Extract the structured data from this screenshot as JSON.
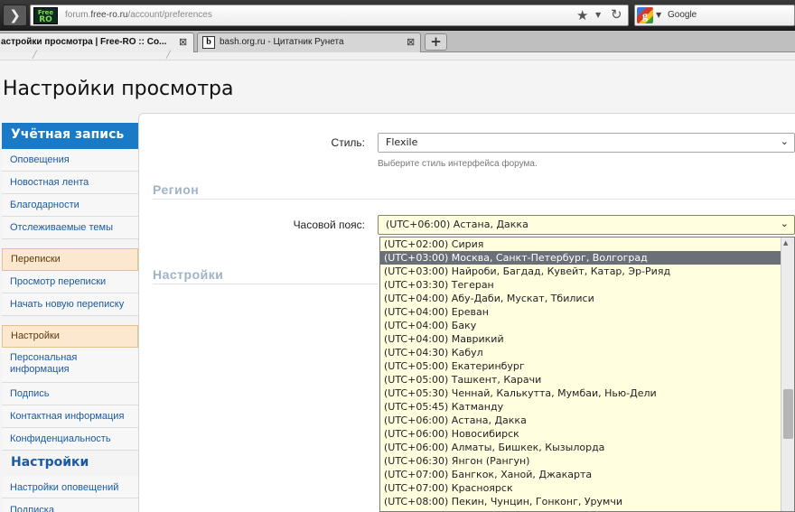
{
  "browser": {
    "back_label": "❯",
    "site_icon_top": "Free",
    "site_icon_bottom": "RO",
    "url_prefix": "forum.",
    "url_domain": "free-ro.ru",
    "url_path": "/account/preferences",
    "search_engine": "Google",
    "tabs": [
      {
        "title": "астройки просмотра | Free-RO :: Co...",
        "close": "⊠"
      },
      {
        "title": "bash.org.ru - Цитатник Рунета",
        "close": "⊠",
        "icon": "b"
      }
    ],
    "new_tab": "+"
  },
  "page": {
    "title": "Настройки просмотра"
  },
  "sidebar": {
    "account_head": "Учётная запись",
    "account_items": [
      "Оповещения",
      "Новостная лента",
      "Благодарности",
      "Отслеживаемые темы"
    ],
    "pm_section": "Переписки",
    "pm_items": [
      "Просмотр переписки",
      "Начать новую переписку"
    ],
    "settings_section": "Настройки",
    "settings_items": [
      "Персональная информация",
      "Подпись",
      "Контактная информация",
      "Конфиденциальность"
    ],
    "settings_head": "Настройки",
    "settings_sub": [
      "Настройки оповещений",
      "Подписка"
    ]
  },
  "form": {
    "style_label": "Стиль:",
    "style_value": "Flexile",
    "style_hint": "Выберите стиль интерфейса форума.",
    "region_title": "Регион",
    "timezone_label": "Часовой пояс:",
    "timezone_value": "(UTC+06:00) Астана, Дакка",
    "settings_title": "Настройки"
  },
  "timezone_options": [
    "(UTC+02:00) Сирия",
    "(UTC+03:00) Москва, Санкт-Петербург, Волгоград",
    "(UTC+03:00) Найроби, Багдад, Кувейт, Катар, Эр-Рияд",
    "(UTC+03:30) Тегеран",
    "(UTC+04:00) Абу-Даби, Мускат, Тбилиси",
    "(UTC+04:00) Ереван",
    "(UTC+04:00) Баку",
    "(UTC+04:00) Маврикий",
    "(UTC+04:30) Кабул",
    "(UTC+05:00) Екатеринбург",
    "(UTC+05:00) Ташкент, Карачи",
    "(UTC+05:30) Ченнай, Калькутта, Мумбаи, Нью-Дели",
    "(UTC+05:45) Катманду",
    "(UTC+06:00) Астана, Дакка",
    "(UTC+06:00) Новосибирск",
    "(UTC+06:00) Алматы, Бишкек, Кызылорда",
    "(UTC+06:30) Янгон (Рангун)",
    "(UTC+07:00) Бангкок, Ханой, Джакарта",
    "(UTC+07:00) Красноярск",
    "(UTC+08:00) Пекин, Чунцин, Гонконг, Урумчи"
  ],
  "highlighted_option": "(UTC+03:00) Москва, Санкт-Петербург, Волгоград",
  "icons": [
    "back-icon",
    "site-icon",
    "star-icon",
    "reload-icon",
    "google-icon",
    "chevron-down-icon",
    "close-icon",
    "new-tab-icon"
  ]
}
